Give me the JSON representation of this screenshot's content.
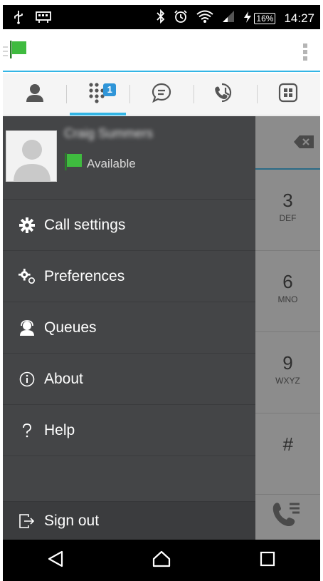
{
  "status_bar": {
    "battery_percent": "16%",
    "time": "14:27",
    "icons": [
      "usb-icon",
      "notification-icon",
      "bluetooth-icon",
      "alarm-icon",
      "wifi-icon",
      "signal-icon",
      "charging-icon"
    ]
  },
  "toolbar": {
    "presence_flag_color": "#3fbb3f",
    "icons": [
      "hamburger-icon",
      "flag-icon",
      "overflow-menu-icon"
    ]
  },
  "tabs": [
    {
      "id": "contacts",
      "icon": "person-icon"
    },
    {
      "id": "dialpad",
      "icon": "dialpad-icon",
      "badge": "1",
      "active": true
    },
    {
      "id": "chat",
      "icon": "chat-icon"
    },
    {
      "id": "history",
      "icon": "history-icon"
    },
    {
      "id": "directory",
      "icon": "building-icon"
    }
  ],
  "drawer": {
    "profile": {
      "name": "Craig Summers",
      "presence": "Available",
      "presence_color": "#3fbb3f"
    },
    "menu": [
      {
        "label": "Call settings",
        "icon": "gear-icon"
      },
      {
        "label": "Preferences",
        "icon": "gears-icon"
      },
      {
        "label": "Queues",
        "icon": "agent-icon"
      },
      {
        "label": "About",
        "icon": "info-icon"
      },
      {
        "label": "Help",
        "icon": "help-icon"
      }
    ],
    "sign_out": {
      "label": "Sign out",
      "icon": "sign-out-icon"
    }
  },
  "dialpad": {
    "keys": [
      {
        "num": "3",
        "letters": "DEF"
      },
      {
        "num": "6",
        "letters": "MNO"
      },
      {
        "num": "9",
        "letters": "WXYZ"
      },
      {
        "num": "#",
        "letters": ""
      }
    ]
  },
  "colors": {
    "accent": "#33b5e5",
    "drawer_bg": "#444547",
    "badge": "#2f95d8"
  }
}
